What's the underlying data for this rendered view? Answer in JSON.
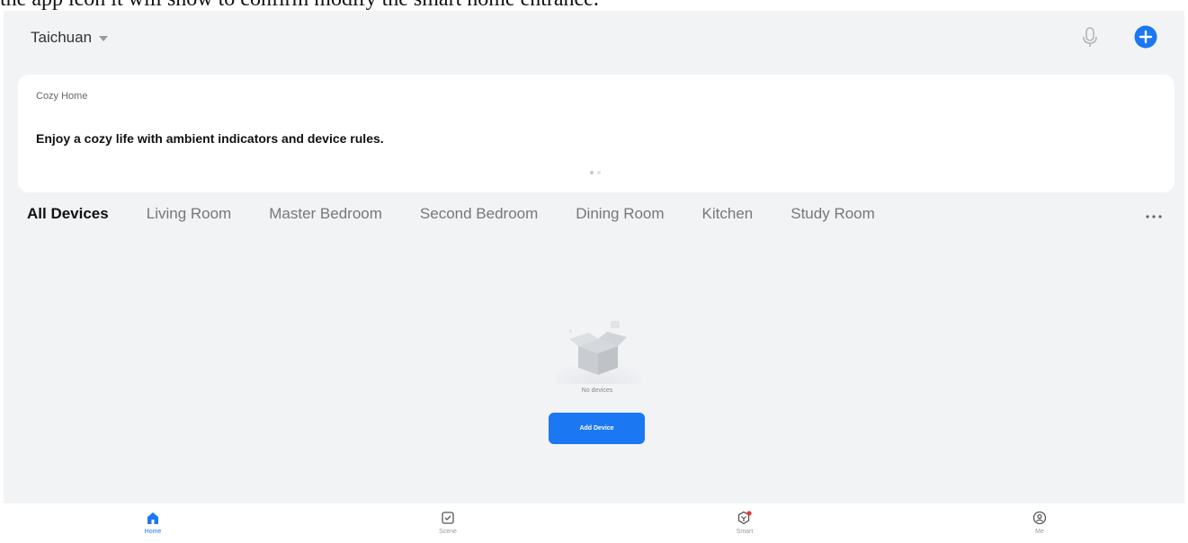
{
  "caption": "the app icon it will show to confirm modify the smart home entrance.",
  "header": {
    "home_name": "Taichuan"
  },
  "banner": {
    "subtitle": "Cozy Home",
    "title": "Enjoy a cozy life with ambient indicators and device rules."
  },
  "room_tabs": [
    {
      "label": "All Devices",
      "active": true
    },
    {
      "label": "Living Room"
    },
    {
      "label": "Master Bedroom"
    },
    {
      "label": "Second Bedroom"
    },
    {
      "label": "Dining Room"
    },
    {
      "label": "Kitchen"
    },
    {
      "label": "Study Room"
    }
  ],
  "empty_state": {
    "message": "No devices",
    "button_label": "Add Device"
  },
  "bottom_nav": [
    {
      "label": "Home",
      "icon": "home-icon",
      "active": true
    },
    {
      "label": "Scene",
      "icon": "scene-icon"
    },
    {
      "label": "Smart",
      "icon": "smart-icon",
      "badge": true
    },
    {
      "label": "Me",
      "icon": "profile-icon"
    }
  ],
  "colors": {
    "accent": "#1b78f2",
    "background": "#f2f3f5",
    "badge": "#e8392e"
  }
}
